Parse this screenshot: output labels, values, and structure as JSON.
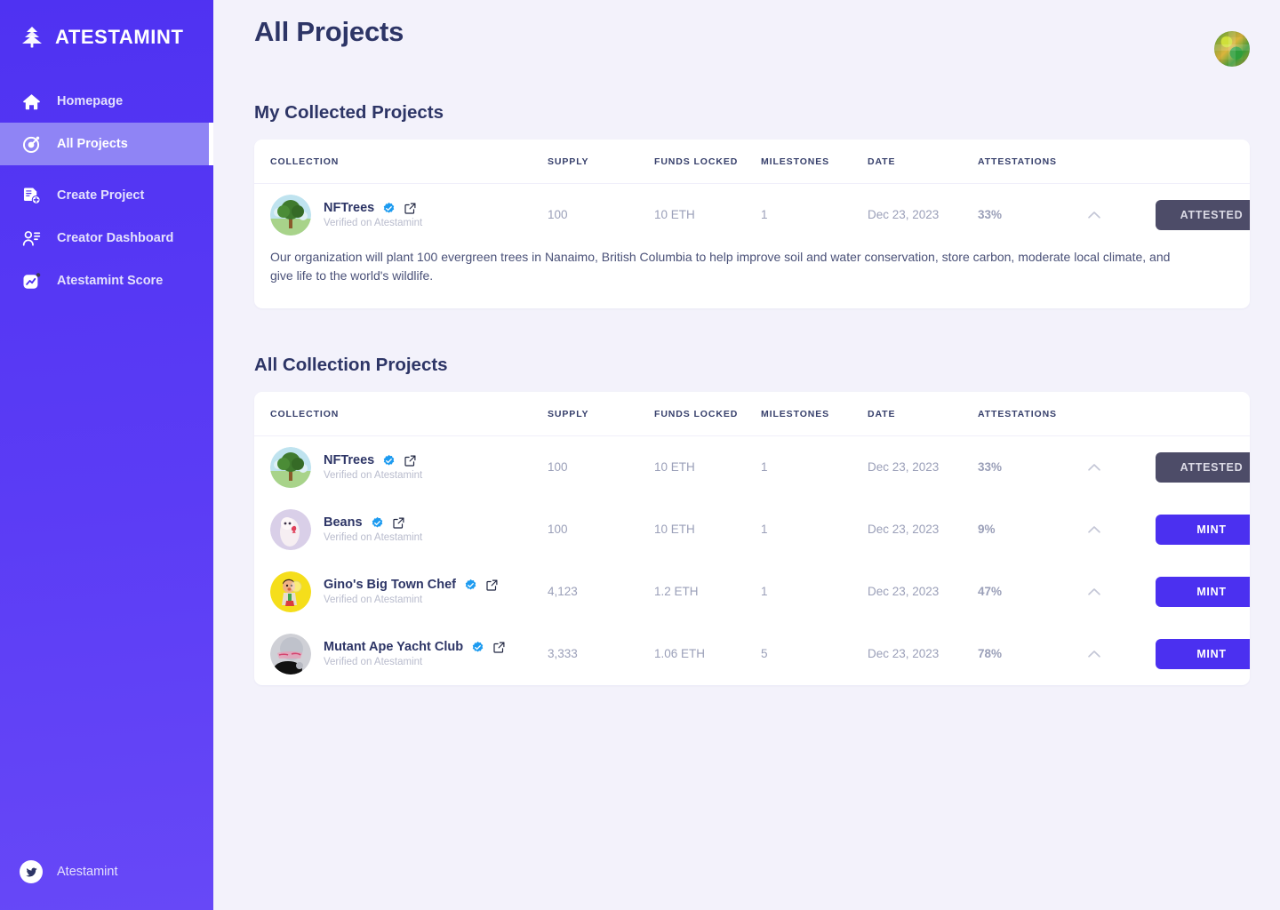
{
  "sidebar": {
    "brand": "ATESTAMINT",
    "brand_logo_icon": "pine-tree-icon",
    "items": [
      {
        "label": "Homepage",
        "icon": "home-icon",
        "active": false
      },
      {
        "label": "All Projects",
        "icon": "target-icon",
        "active": true
      },
      {
        "label": "Create Project",
        "icon": "document-add-icon",
        "active": false
      },
      {
        "label": "Creator Dashboard",
        "icon": "user-list-icon",
        "active": false
      },
      {
        "label": "Atestamint Score",
        "icon": "chart-square-icon",
        "active": false
      }
    ],
    "footer": {
      "label": "Atestamint",
      "icon": "twitter-icon"
    }
  },
  "header": {
    "title": "All Projects",
    "avatar_icon": "pixel-avatar"
  },
  "sections": [
    {
      "title": "My Collected Projects"
    },
    {
      "title": "All Collection Projects"
    }
  ],
  "table": {
    "columns": [
      "COLLECTION",
      "SUPPLY",
      "FUNDS LOCKED",
      "MILESTONES",
      "DATE",
      "ATTESTATIONS"
    ]
  },
  "collected_projects": [
    {
      "name": "NFTrees",
      "verified_label": "Verified on Atestamint",
      "supply": "100",
      "funds_locked": "10 ETH",
      "milestones": "1",
      "date": "Dec 23, 2023",
      "attestations": "33%",
      "action": "ATTESTED",
      "action_state": "attested",
      "expanded": true,
      "description": "Our organization will plant 100 evergreen trees in Nanaimo, British Columbia to help improve soil and water conservation, store carbon, moderate local climate, and give life to the world's wildlife."
    }
  ],
  "all_projects": [
    {
      "name": "NFTrees",
      "verified_label": "Verified on Atestamint",
      "supply": "100",
      "funds_locked": "10 ETH",
      "milestones": "1",
      "date": "Dec 23, 2023",
      "attestations": "33%",
      "action": "ATTESTED",
      "action_state": "attested"
    },
    {
      "name": "Beans",
      "verified_label": "Verified on Atestamint",
      "supply": "100",
      "funds_locked": "10 ETH",
      "milestones": "1",
      "date": "Dec 23, 2023",
      "attestations": "9%",
      "action": "MINT",
      "action_state": "mint"
    },
    {
      "name": "Gino's Big Town Chef",
      "verified_label": "Verified on Atestamint",
      "supply": "4,123",
      "funds_locked": "1.2 ETH",
      "milestones": "1",
      "date": "Dec 23, 2023",
      "attestations": "47%",
      "action": "MINT",
      "action_state": "mint"
    },
    {
      "name": "Mutant Ape Yacht Club",
      "verified_label": "Verified on Atestamint",
      "supply": "3,333",
      "funds_locked": "1.06 ETH",
      "milestones": "5",
      "date": "Dec 23, 2023",
      "attestations": "78%",
      "action": "MINT",
      "action_state": "mint"
    }
  ],
  "colors": {
    "brand_purple": "#4b30f0",
    "sidebar_active": "#8f84f5",
    "heading_navy": "#2d3566",
    "page_bg": "#f3f2fb",
    "attested_btn": "#4d4c68",
    "accent_percent": "#4b30f0",
    "verified_blue": "#1d9bf0"
  }
}
